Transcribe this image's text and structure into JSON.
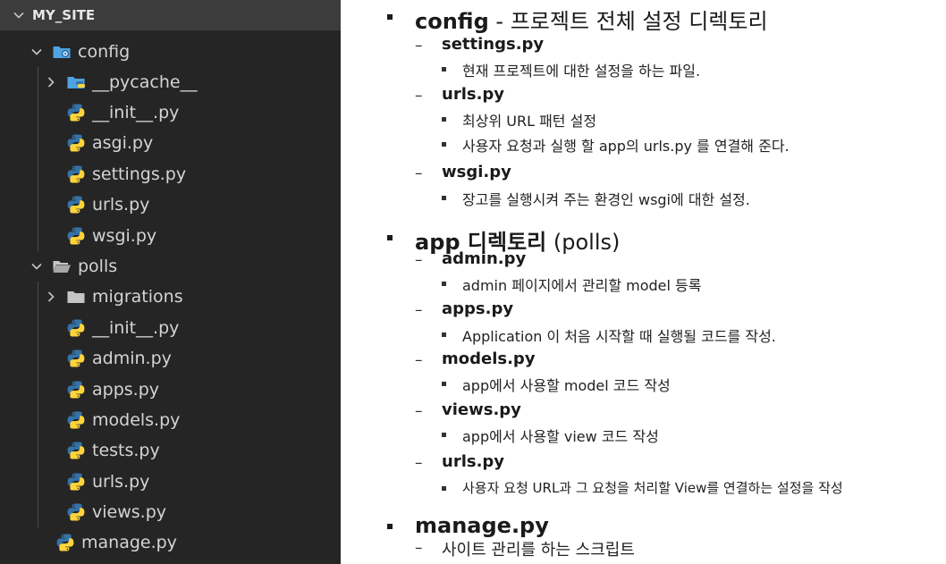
{
  "explorer": {
    "title": "MY_SITE",
    "items": [
      {
        "label": "config",
        "icon": "folder-config-icon",
        "expanded": true
      },
      {
        "label": "__pycache__",
        "icon": "folder-python-icon",
        "expanded": false
      },
      {
        "label": "__init__.py",
        "icon": "python-icon"
      },
      {
        "label": "asgi.py",
        "icon": "python-icon"
      },
      {
        "label": "settings.py",
        "icon": "python-icon"
      },
      {
        "label": "urls.py",
        "icon": "python-icon"
      },
      {
        "label": "wsgi.py",
        "icon": "python-icon"
      },
      {
        "label": "polls",
        "icon": "folder-open-icon",
        "expanded": true
      },
      {
        "label": "migrations",
        "icon": "folder-icon",
        "expanded": false
      },
      {
        "label": "__init__.py",
        "icon": "python-icon"
      },
      {
        "label": "admin.py",
        "icon": "python-icon"
      },
      {
        "label": "apps.py",
        "icon": "python-icon"
      },
      {
        "label": "models.py",
        "icon": "python-icon"
      },
      {
        "label": "tests.py",
        "icon": "python-icon"
      },
      {
        "label": "urls.py",
        "icon": "python-icon"
      },
      {
        "label": "views.py",
        "icon": "python-icon"
      },
      {
        "label": "manage.py",
        "icon": "python-icon"
      }
    ]
  },
  "notes": {
    "config": {
      "name": "config",
      "desc": " - 프로젝트 전체 설정 디렉토리",
      "settings": {
        "name": "settings.py",
        "desc": "현재 프로젝트에 대한 설정을 하는 파일."
      },
      "urls": {
        "name": "urls.py",
        "desc1": "최상위 URL 패턴 설정",
        "desc2": "사용자 요청과 실행 할 app의 urls.py 를 연결해 준다."
      },
      "wsgi": {
        "name": "wsgi.py",
        "desc": " 장고를 실행시켜 주는 환경인 wsgi에 대한 설정."
      }
    },
    "app": {
      "name": "app 디렉토리",
      "suffix": " (polls)",
      "admin": {
        "name": "admin.py",
        "desc": "admin 페이지에서 관리할 model 등록"
      },
      "apps": {
        "name": "apps.py",
        "desc": "Application 이 처음 시작할 때 실행될 코드를 작성."
      },
      "models": {
        "name": "models.py",
        "desc": "app에서 사용할 model 코드 작성"
      },
      "views": {
        "name": "views.py",
        "desc": "app에서 사용할 view 코드 작성"
      },
      "urls": {
        "name": "urls.py",
        "desc": "사용자 요청 URL과 그 요청을 처리할 View를 연결하는 설정을 작성"
      }
    },
    "manage": {
      "name": "manage.py",
      "desc": "사이트 관리를 하는 스크립트"
    }
  },
  "colors": {
    "explorer_bg": "#252526",
    "header_bg": "#3c3c3c",
    "folder_blue": "#4fa3e0",
    "folder_gray": "#c5c5c5",
    "python_blue": "#3572a5",
    "python_yellow": "#ffd43b"
  }
}
